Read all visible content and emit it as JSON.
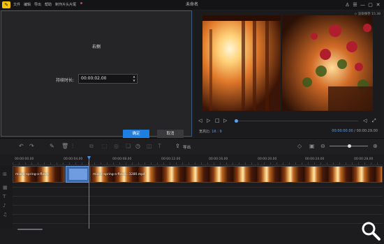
{
  "titlebar": {
    "logo_glyph": "✎",
    "menu": [
      "文件",
      "编辑",
      "导出",
      "帮助",
      "制作片头片尾"
    ],
    "title": "未命名",
    "controls": [
      "♙",
      "☰",
      "—",
      "▢",
      "✕"
    ]
  },
  "dialog": {
    "title": "右侧",
    "duration_label": "持续时长:",
    "duration_value": "00:00:02.00",
    "ok_label": "确定",
    "cancel_label": "取消"
  },
  "preview": {
    "render_info": "◇ 渲染保存 15.38",
    "aspect_label": "宽高比:",
    "aspect_value": "16 : 9",
    "current_time": "00:00:00.00",
    "separator": "/",
    "total_time": "00:00:29.00",
    "progress_fraction": 0
  },
  "toolbar": {
    "export_label": "导出",
    "zoom_level": 0.5
  },
  "timeline": {
    "ruler": [
      "00:00:00.00",
      "00:00:04.00",
      "00:00:08.00",
      "00:00:12.00",
      "00:00:16.00",
      "00:00:20.00",
      "00:00:24.00",
      "00:00:28.00"
    ],
    "clip_a_label": "mixkit-spring-a-flowe",
    "clip_c_label": "mixkit-spring-a-flowe...1280.mp4"
  },
  "colors": {
    "accent": "#1f7fe0",
    "playhead": "#4a90e2",
    "background": "#1f1f21"
  }
}
